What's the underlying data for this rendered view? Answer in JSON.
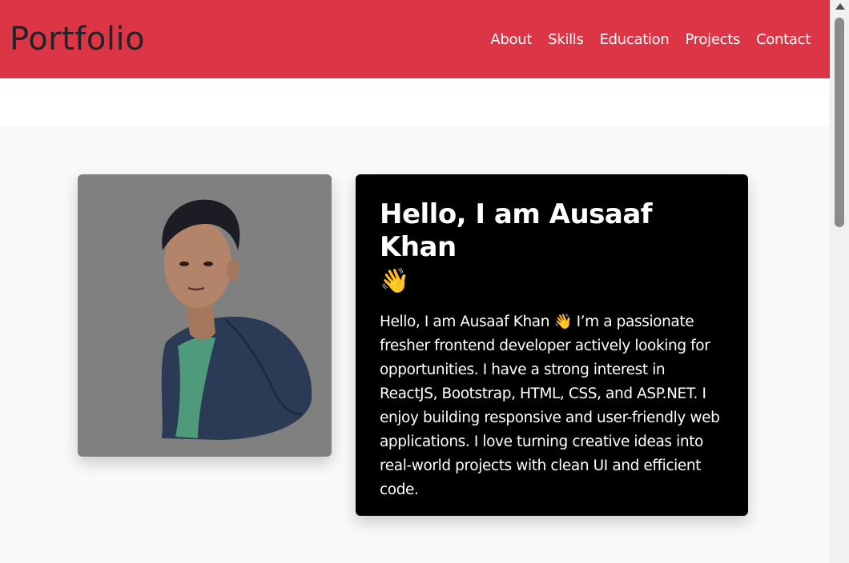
{
  "navbar": {
    "brand": "Portfolio",
    "links": [
      "About",
      "Skills",
      "Education",
      "Projects",
      "Contact"
    ]
  },
  "about": {
    "title": "Hello, I am Ausaaf Khan",
    "title_emoji": "👋",
    "paragraph": "Hello, I am Ausaaf Khan 👋 I’m a passionate fresher frontend developer actively looking for opportunities. I have a strong interest in ReactJS, Bootstrap, HTML, CSS, and ASP.NET. I enjoy building responsive and user-friendly web applications. I love turning creative ideas into real-world projects with clean UI and efficient code."
  },
  "colors": {
    "navbar": "#dc3545",
    "brand_text": "#212529",
    "photo_bg": "#808080",
    "about_bg": "#000000",
    "page_bg": "#f8f9fa"
  }
}
